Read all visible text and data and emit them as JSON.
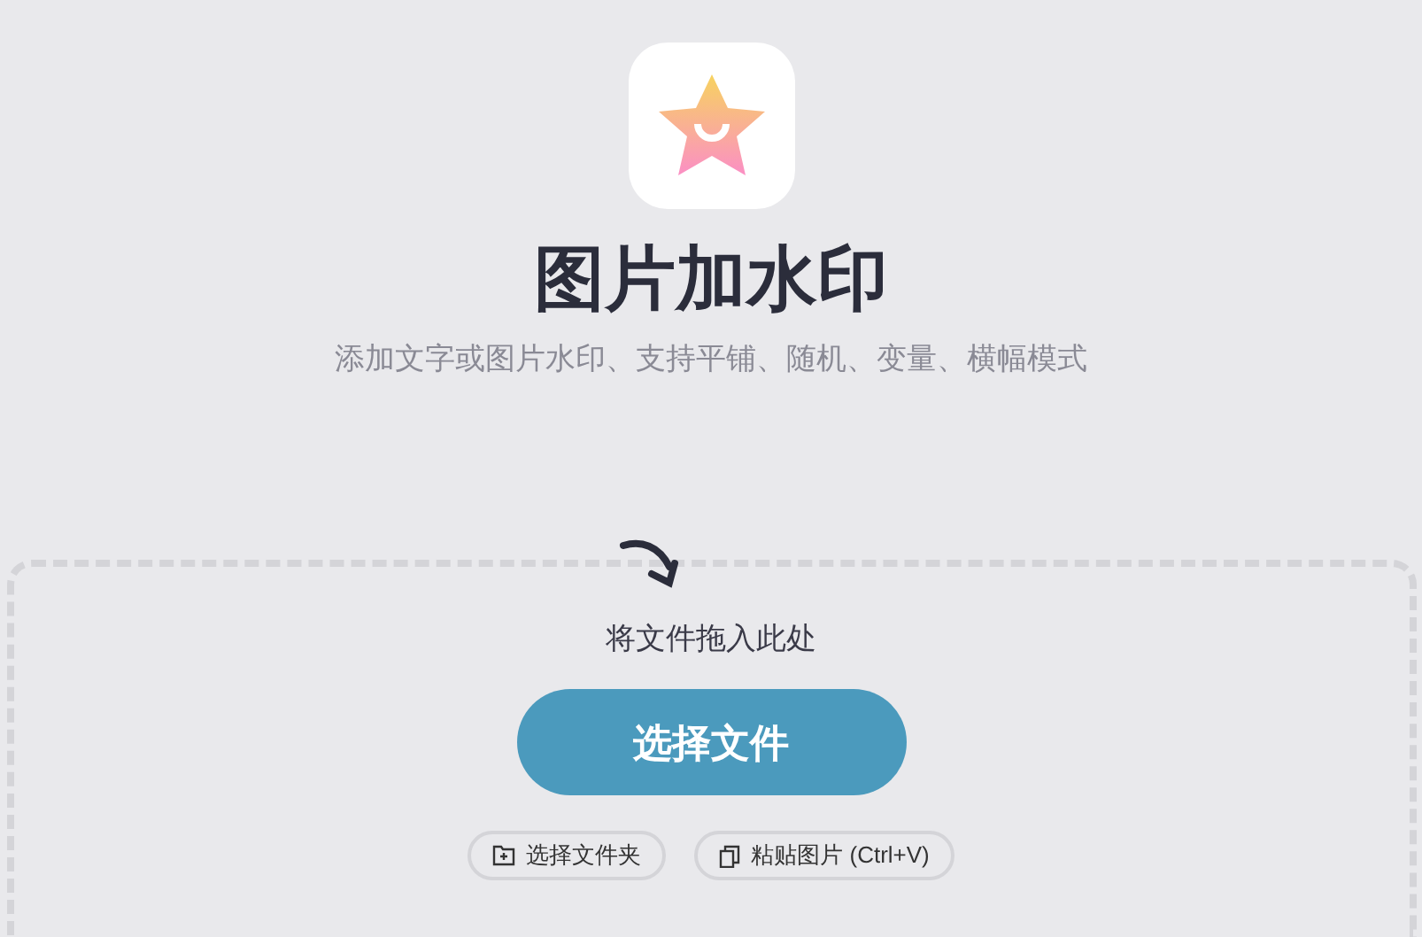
{
  "title": "图片加水印",
  "subtitle": "添加文字或图片水印、支持平铺、随机、变量、横幅模式",
  "dropzone": {
    "hint": "将文件拖入此处",
    "primary_button": "选择文件",
    "secondary_buttons": [
      {
        "kind": "folder",
        "label": "选择文件夹"
      },
      {
        "kind": "paste",
        "label": "粘贴图片 (Ctrl+V)"
      }
    ]
  }
}
